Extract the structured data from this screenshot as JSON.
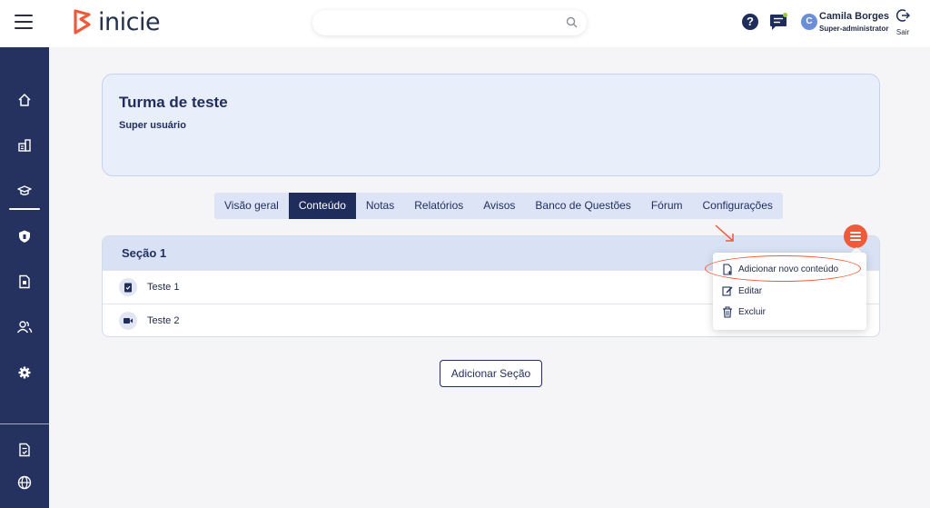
{
  "header": {
    "logo_text": "inicie",
    "search": {
      "placeholder": "",
      "value": ""
    },
    "help_label": "?",
    "user": {
      "initial": "C",
      "name": "Camila Borges",
      "role": "Super-administrator"
    },
    "logout_label": "Sair"
  },
  "sidebar": {
    "items": [
      {
        "name": "home-icon",
        "active": false
      },
      {
        "name": "building-icon",
        "active": false
      },
      {
        "name": "graduation-cap-icon",
        "active": true
      },
      {
        "name": "shield-icon",
        "active": false
      },
      {
        "name": "document-icon",
        "active": false
      },
      {
        "name": "users-icon",
        "active": false
      },
      {
        "name": "gear-icon",
        "active": false
      },
      {
        "name": "report-icon",
        "active": false
      },
      {
        "name": "globe-icon",
        "active": false
      }
    ]
  },
  "course": {
    "title": "Turma de teste",
    "subtitle": "Super usuário"
  },
  "tabs": [
    {
      "label": "Visão geral",
      "active": false
    },
    {
      "label": "Conteúdo",
      "active": true
    },
    {
      "label": "Notas",
      "active": false
    },
    {
      "label": "Relatórios",
      "active": false
    },
    {
      "label": "Avisos",
      "active": false
    },
    {
      "label": "Banco de Questões",
      "active": false
    },
    {
      "label": "Fórum",
      "active": false
    },
    {
      "label": "Configurações",
      "active": false
    }
  ],
  "section": {
    "title": "Seção 1",
    "items": [
      {
        "label": "Teste 1",
        "icon": "clipboard-check-icon"
      },
      {
        "label": "Teste 2",
        "icon": "video-camera-icon"
      }
    ]
  },
  "menu": {
    "items": [
      {
        "label": "Adicionar novo conteúdo",
        "icon": "file-plus-icon"
      },
      {
        "label": "Editar",
        "icon": "edit-icon"
      },
      {
        "label": "Excluir",
        "icon": "trash-icon"
      }
    ]
  },
  "add_section_label": "Adicionar Seção",
  "colors": {
    "primary": "#1f2d5c",
    "accent": "#ef5b3a",
    "sidebar": "#25315e",
    "card": "#e9eefb"
  }
}
